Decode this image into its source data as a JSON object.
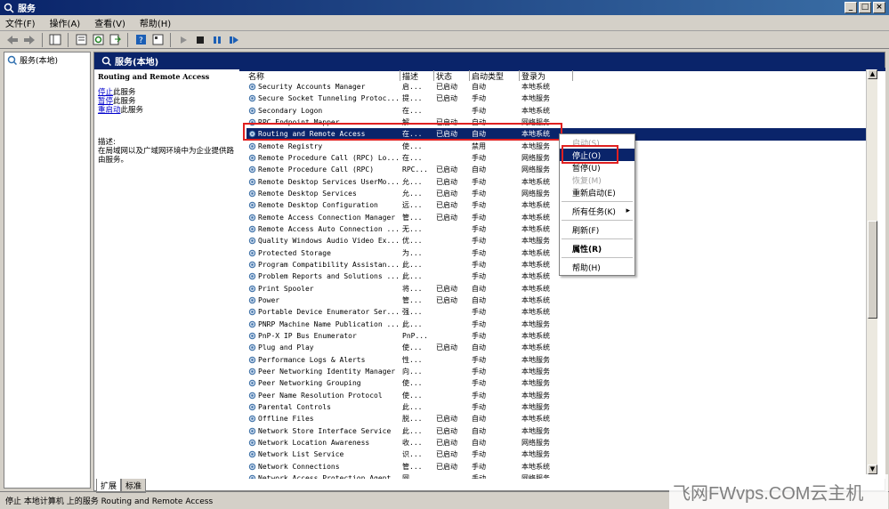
{
  "window": {
    "title": "服务",
    "min": "_",
    "max": "□",
    "close": "×"
  },
  "menu": [
    "文件(F)",
    "操作(A)",
    "查看(V)",
    "帮助(H)"
  ],
  "tree": {
    "root": "服务(本地)"
  },
  "pane": {
    "header": "服务(本地)",
    "service_name": "Routing and Remote Access",
    "links": [
      {
        "link": "停止",
        "rest": "此服务"
      },
      {
        "link": "暂停",
        "rest": "此服务"
      },
      {
        "link": "重启动",
        "rest": "此服务"
      }
    ],
    "desc_label": "描述:",
    "desc_text": "在局域网以及广域网环境中为企业提供路由服务。"
  },
  "columns": [
    "名称",
    "描述",
    "状态",
    "启动类型",
    "登录为"
  ],
  "rows": [
    [
      "Security Accounts Manager",
      "启...",
      "已启动",
      "自动",
      "本地系统"
    ],
    [
      "Secure Socket Tunneling Protoc...",
      "提...",
      "已启动",
      "手动",
      "本地服务"
    ],
    [
      "Secondary Logon",
      "在...",
      "",
      "手动",
      "本地系统"
    ],
    [
      "RPC Endpoint Mapper",
      "解...",
      "已启动",
      "自动",
      "网络服务"
    ],
    [
      "Routing and Remote Access",
      "在...",
      "已启动",
      "自动",
      "本地系统"
    ],
    [
      "Remote Registry",
      "使...",
      "",
      "禁用",
      "本地服务"
    ],
    [
      "Remote Procedure Call (RPC) Lo...",
      "在...",
      "",
      "手动",
      "网络服务"
    ],
    [
      "Remote Procedure Call (RPC)",
      "RPC...",
      "已启动",
      "自动",
      "网络服务"
    ],
    [
      "Remote Desktop Services UserMo...",
      "允...",
      "已启动",
      "手动",
      "本地系统"
    ],
    [
      "Remote Desktop Services",
      "允...",
      "已启动",
      "手动",
      "网络服务"
    ],
    [
      "Remote Desktop Configuration",
      "远...",
      "已启动",
      "手动",
      "本地系统"
    ],
    [
      "Remote Access Connection Manager",
      "管...",
      "已启动",
      "手动",
      "本地系统"
    ],
    [
      "Remote Access Auto Connection ...",
      "无...",
      "",
      "手动",
      "本地系统"
    ],
    [
      "Quality Windows Audio Video Ex...",
      "优...",
      "",
      "手动",
      "本地服务"
    ],
    [
      "Protected Storage",
      "为...",
      "",
      "手动",
      "本地系统"
    ],
    [
      "Program Compatibility Assistan...",
      "此...",
      "",
      "手动",
      "本地系统"
    ],
    [
      "Problem Reports and Solutions ...",
      "此...",
      "",
      "手动",
      "本地系统"
    ],
    [
      "Print Spooler",
      "将...",
      "已启动",
      "自动",
      "本地系统"
    ],
    [
      "Power",
      "管...",
      "已启动",
      "自动",
      "本地系统"
    ],
    [
      "Portable Device Enumerator Ser...",
      "强...",
      "",
      "手动",
      "本地系统"
    ],
    [
      "PNRP Machine Name Publication ...",
      "此...",
      "",
      "手动",
      "本地服务"
    ],
    [
      "PnP-X IP Bus Enumerator",
      "PnP...",
      "",
      "手动",
      "本地系统"
    ],
    [
      "Plug and Play",
      "使...",
      "已启动",
      "自动",
      "本地系统"
    ],
    [
      "Performance Logs & Alerts",
      "性...",
      "",
      "手动",
      "本地服务"
    ],
    [
      "Peer Networking Identity Manager",
      "向...",
      "",
      "手动",
      "本地服务"
    ],
    [
      "Peer Networking Grouping",
      "使...",
      "",
      "手动",
      "本地服务"
    ],
    [
      "Peer Name Resolution Protocol",
      "使...",
      "",
      "手动",
      "本地服务"
    ],
    [
      "Parental Controls",
      "此...",
      "",
      "手动",
      "本地服务"
    ],
    [
      "Offline Files",
      "脱...",
      "已启动",
      "自动",
      "本地系统"
    ],
    [
      "Network Store Interface Service",
      "此...",
      "已启动",
      "自动",
      "本地服务"
    ],
    [
      "Network Location Awareness",
      "收...",
      "已启动",
      "自动",
      "网络服务"
    ],
    [
      "Network List Service",
      "识...",
      "已启动",
      "手动",
      "本地服务"
    ],
    [
      "Network Connections",
      "管...",
      "已启动",
      "手动",
      "本地系统"
    ],
    [
      "Network Access Protection Agent",
      "网...",
      "",
      "手动",
      "网络服务"
    ]
  ],
  "context_menu": {
    "start": "启动(S)",
    "stop": "停止(O)",
    "pause": "暂停(U)",
    "resume": "恢复(M)",
    "restart": "重新启动(E)",
    "all_tasks": "所有任务(K)",
    "refresh": "刷新(F)",
    "properties": "属性(R)",
    "help": "帮助(H)"
  },
  "tabs": [
    "扩展",
    "标准"
  ],
  "status": "停止 本地计算机 上的服务 Routing and Remote Access",
  "watermark": "飞网FWvps.COM云主机"
}
